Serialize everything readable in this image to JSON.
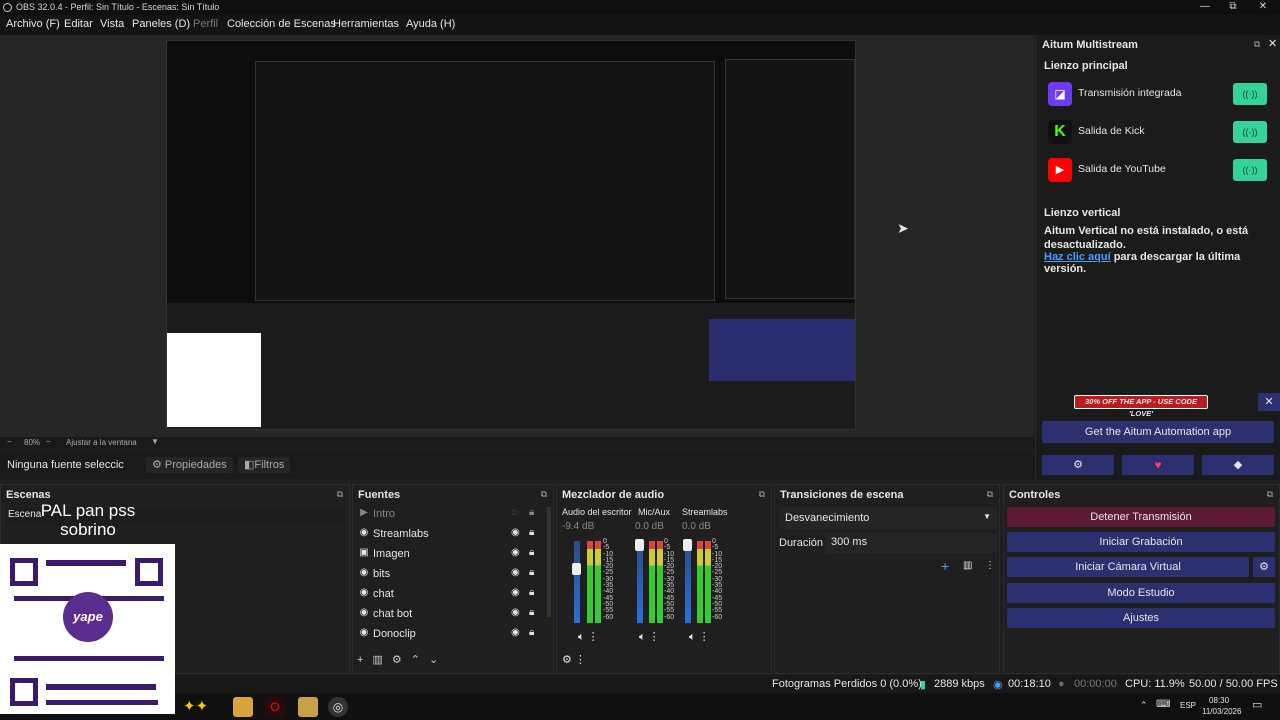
{
  "window": {
    "title": "OBS 32.0.4 - Perfil: Sin Título - Escenas: Sin Título",
    "minimize": "—",
    "maximize": "⧉",
    "close": "✕"
  },
  "menu": [
    {
      "label": "Archivo (F)"
    },
    {
      "label": "Editar"
    },
    {
      "label": "Vista"
    },
    {
      "label": "Paneles (D)"
    },
    {
      "label": "Perfil"
    },
    {
      "label": "Colección de Escenas"
    },
    {
      "label": "Herramientas"
    },
    {
      "label": "Ayuda (H)"
    }
  ],
  "zoom": {
    "value": "80%",
    "fit": "Ajustar a la ventana"
  },
  "source_bar": {
    "none": "Ninguna fuente seleccic",
    "properties": "Propiedades",
    "filters": "Filtros"
  },
  "multistream": {
    "title": "Aitum Multistream",
    "main_canvas": "Lienzo principal",
    "outputs": [
      {
        "name": "Transmisión integrada",
        "color": "#6e3cf0"
      },
      {
        "name": "Salida de Kick",
        "color": "#53fc18"
      },
      {
        "name": "Salida de YouTube",
        "color": "#ff0000"
      }
    ],
    "vertical_title": "Lienzo vertical",
    "vertical_msg": "Aitum Vertical no está instalado, o está desactualizado.",
    "vertical_link": "Haz clic aquí",
    "vertical_rest": " para descargar la última versión.",
    "promo": "30% OFF THE APP - USE CODE 'LOVE'",
    "app_button": "Get the Aitum Automation app"
  },
  "scenes": {
    "title": "Escenas",
    "item": "Escena"
  },
  "overlay": {
    "line1": "PAL pan pss",
    "line2": "sobrino",
    "qr_brand": "yape"
  },
  "sources": {
    "title": "Fuentes",
    "items": [
      {
        "name": "Intro",
        "icon": "▶"
      },
      {
        "name": "Streamlabs",
        "icon": "◉"
      },
      {
        "name": "Imagen",
        "icon": "▣"
      },
      {
        "name": "bits",
        "icon": "◉"
      },
      {
        "name": "chat",
        "icon": "◉"
      },
      {
        "name": "chat bot",
        "icon": "◉"
      },
      {
        "name": "Donoclip",
        "icon": "◉"
      }
    ]
  },
  "mixer": {
    "title": "Mezclador de audio",
    "channels": [
      {
        "name": "Audio del escritor",
        "db": "-9.4 dB"
      },
      {
        "name": "Mic/Aux",
        "db": "0.0 dB"
      },
      {
        "name": "Streamlabs",
        "db": "0.0 dB"
      }
    ],
    "scale": [
      "0",
      "-5",
      "-10",
      "-15",
      "-20",
      "-25",
      "-30",
      "-35",
      "-40",
      "-45",
      "-50",
      "-55",
      "-60"
    ]
  },
  "transitions": {
    "title": "Transiciones de escena",
    "type": "Desvanecimiento",
    "duration_label": "Duración",
    "duration": "300 ms"
  },
  "controls": {
    "title": "Controles",
    "buttons": [
      "Detener Transmisión",
      "Iniciar Grabación",
      "Iniciar Cámara Virtual",
      "Modo Estudio",
      "Ajustes"
    ]
  },
  "status": {
    "dropped": "Fotogramas Perdidos 0 (0.0%)",
    "bitrate": "2889 kbps",
    "stream_time": "00:18:10",
    "rec_time": "00:00:00",
    "cpu": "CPU: 11.9%",
    "fps": "50.00 / 50.00 FPS"
  },
  "taskbar": {
    "lang": "ESP",
    "time": "08:30",
    "date": "11/03/2026"
  }
}
